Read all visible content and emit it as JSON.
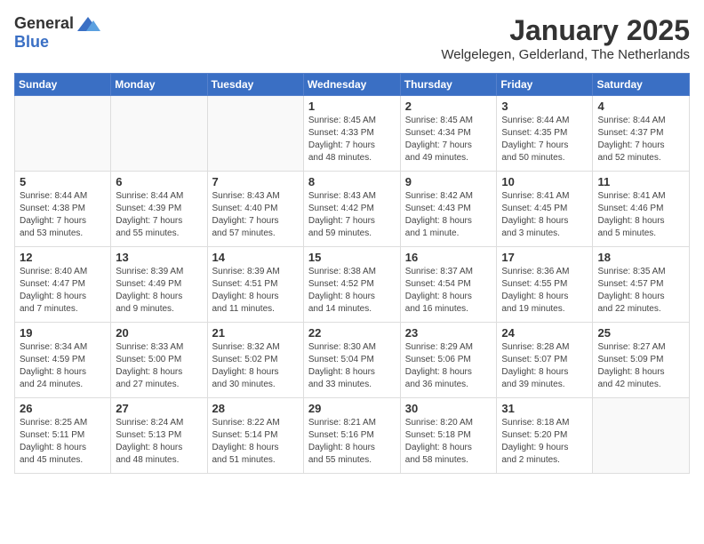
{
  "logo": {
    "general": "General",
    "blue": "Blue"
  },
  "title": "January 2025",
  "location": "Welgelegen, Gelderland, The Netherlands",
  "weekdays": [
    "Sunday",
    "Monday",
    "Tuesday",
    "Wednesday",
    "Thursday",
    "Friday",
    "Saturday"
  ],
  "weeks": [
    [
      {
        "day": "",
        "info": ""
      },
      {
        "day": "",
        "info": ""
      },
      {
        "day": "",
        "info": ""
      },
      {
        "day": "1",
        "info": "Sunrise: 8:45 AM\nSunset: 4:33 PM\nDaylight: 7 hours\nand 48 minutes."
      },
      {
        "day": "2",
        "info": "Sunrise: 8:45 AM\nSunset: 4:34 PM\nDaylight: 7 hours\nand 49 minutes."
      },
      {
        "day": "3",
        "info": "Sunrise: 8:44 AM\nSunset: 4:35 PM\nDaylight: 7 hours\nand 50 minutes."
      },
      {
        "day": "4",
        "info": "Sunrise: 8:44 AM\nSunset: 4:37 PM\nDaylight: 7 hours\nand 52 minutes."
      }
    ],
    [
      {
        "day": "5",
        "info": "Sunrise: 8:44 AM\nSunset: 4:38 PM\nDaylight: 7 hours\nand 53 minutes."
      },
      {
        "day": "6",
        "info": "Sunrise: 8:44 AM\nSunset: 4:39 PM\nDaylight: 7 hours\nand 55 minutes."
      },
      {
        "day": "7",
        "info": "Sunrise: 8:43 AM\nSunset: 4:40 PM\nDaylight: 7 hours\nand 57 minutes."
      },
      {
        "day": "8",
        "info": "Sunrise: 8:43 AM\nSunset: 4:42 PM\nDaylight: 7 hours\nand 59 minutes."
      },
      {
        "day": "9",
        "info": "Sunrise: 8:42 AM\nSunset: 4:43 PM\nDaylight: 8 hours\nand 1 minute."
      },
      {
        "day": "10",
        "info": "Sunrise: 8:41 AM\nSunset: 4:45 PM\nDaylight: 8 hours\nand 3 minutes."
      },
      {
        "day": "11",
        "info": "Sunrise: 8:41 AM\nSunset: 4:46 PM\nDaylight: 8 hours\nand 5 minutes."
      }
    ],
    [
      {
        "day": "12",
        "info": "Sunrise: 8:40 AM\nSunset: 4:47 PM\nDaylight: 8 hours\nand 7 minutes."
      },
      {
        "day": "13",
        "info": "Sunrise: 8:39 AM\nSunset: 4:49 PM\nDaylight: 8 hours\nand 9 minutes."
      },
      {
        "day": "14",
        "info": "Sunrise: 8:39 AM\nSunset: 4:51 PM\nDaylight: 8 hours\nand 11 minutes."
      },
      {
        "day": "15",
        "info": "Sunrise: 8:38 AM\nSunset: 4:52 PM\nDaylight: 8 hours\nand 14 minutes."
      },
      {
        "day": "16",
        "info": "Sunrise: 8:37 AM\nSunset: 4:54 PM\nDaylight: 8 hours\nand 16 minutes."
      },
      {
        "day": "17",
        "info": "Sunrise: 8:36 AM\nSunset: 4:55 PM\nDaylight: 8 hours\nand 19 minutes."
      },
      {
        "day": "18",
        "info": "Sunrise: 8:35 AM\nSunset: 4:57 PM\nDaylight: 8 hours\nand 22 minutes."
      }
    ],
    [
      {
        "day": "19",
        "info": "Sunrise: 8:34 AM\nSunset: 4:59 PM\nDaylight: 8 hours\nand 24 minutes."
      },
      {
        "day": "20",
        "info": "Sunrise: 8:33 AM\nSunset: 5:00 PM\nDaylight: 8 hours\nand 27 minutes."
      },
      {
        "day": "21",
        "info": "Sunrise: 8:32 AM\nSunset: 5:02 PM\nDaylight: 8 hours\nand 30 minutes."
      },
      {
        "day": "22",
        "info": "Sunrise: 8:30 AM\nSunset: 5:04 PM\nDaylight: 8 hours\nand 33 minutes."
      },
      {
        "day": "23",
        "info": "Sunrise: 8:29 AM\nSunset: 5:06 PM\nDaylight: 8 hours\nand 36 minutes."
      },
      {
        "day": "24",
        "info": "Sunrise: 8:28 AM\nSunset: 5:07 PM\nDaylight: 8 hours\nand 39 minutes."
      },
      {
        "day": "25",
        "info": "Sunrise: 8:27 AM\nSunset: 5:09 PM\nDaylight: 8 hours\nand 42 minutes."
      }
    ],
    [
      {
        "day": "26",
        "info": "Sunrise: 8:25 AM\nSunset: 5:11 PM\nDaylight: 8 hours\nand 45 minutes."
      },
      {
        "day": "27",
        "info": "Sunrise: 8:24 AM\nSunset: 5:13 PM\nDaylight: 8 hours\nand 48 minutes."
      },
      {
        "day": "28",
        "info": "Sunrise: 8:22 AM\nSunset: 5:14 PM\nDaylight: 8 hours\nand 51 minutes."
      },
      {
        "day": "29",
        "info": "Sunrise: 8:21 AM\nSunset: 5:16 PM\nDaylight: 8 hours\nand 55 minutes."
      },
      {
        "day": "30",
        "info": "Sunrise: 8:20 AM\nSunset: 5:18 PM\nDaylight: 8 hours\nand 58 minutes."
      },
      {
        "day": "31",
        "info": "Sunrise: 8:18 AM\nSunset: 5:20 PM\nDaylight: 9 hours\nand 2 minutes."
      },
      {
        "day": "",
        "info": ""
      }
    ]
  ]
}
